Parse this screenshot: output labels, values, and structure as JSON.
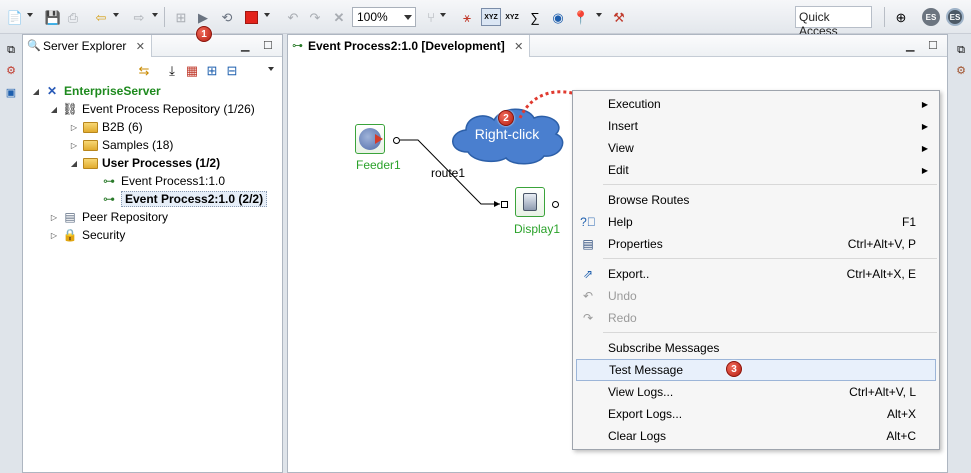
{
  "toolbar": {
    "zoom": "100%",
    "quick_access": "Quick Access"
  },
  "server_explorer": {
    "tab_label": "Server Explorer",
    "tree": {
      "root": "EnterpriseServer",
      "event_process_repository": "Event Process Repository (1/26)",
      "b2b": "B2B (6)",
      "samples": "Samples (18)",
      "user_processes": "User Processes (1/2)",
      "event_process_1": "Event Process1:1.0",
      "event_process_2": "Event Process2:1.0 (2/2)",
      "peer_repository": "Peer Repository",
      "security": "Security"
    }
  },
  "editor": {
    "tab_label": "Event Process2:1.0 [Development]",
    "nodes": {
      "feeder": "Feeder1",
      "display": "Display1",
      "route": "route1"
    },
    "callout": "Right-click"
  },
  "context_menu": {
    "items": [
      {
        "label": "Execution",
        "shortcut": "",
        "submenu": true
      },
      {
        "label": "Insert",
        "shortcut": "",
        "submenu": true
      },
      {
        "label": "View",
        "shortcut": "",
        "submenu": true
      },
      {
        "label": "Edit",
        "shortcut": "",
        "submenu": true
      },
      {
        "label": "Browse Routes",
        "shortcut": ""
      },
      {
        "label": "Help",
        "shortcut": "F1",
        "icon": "help-icon"
      },
      {
        "label": "Properties",
        "shortcut": "Ctrl+Alt+V, P",
        "icon": "properties-icon"
      },
      {
        "label": "Export..",
        "shortcut": "Ctrl+Alt+X, E",
        "icon": "export-icon"
      },
      {
        "label": "Undo",
        "shortcut": "",
        "disabled": true,
        "icon": "undo-icon"
      },
      {
        "label": "Redo",
        "shortcut": "",
        "disabled": true,
        "icon": "redo-icon"
      },
      {
        "label": "Subscribe Messages",
        "shortcut": ""
      },
      {
        "label": "Test Message",
        "shortcut": "",
        "highlighted": true
      },
      {
        "label": "View Logs...",
        "shortcut": "Ctrl+Alt+V, L"
      },
      {
        "label": "Export Logs...",
        "shortcut": "Alt+X"
      },
      {
        "label": "Clear Logs",
        "shortcut": "Alt+C"
      }
    ]
  },
  "badges": {
    "one": "1",
    "two": "2",
    "three": "3"
  }
}
